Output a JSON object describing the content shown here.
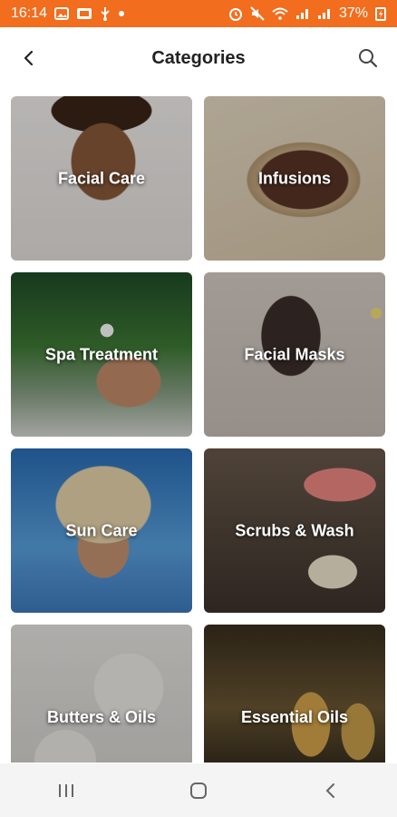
{
  "status_bar": {
    "time": "16:14",
    "battery": "37%",
    "left_icons": [
      "image-icon",
      "gallery-icon",
      "usb-icon",
      "dot-icon"
    ],
    "right_icons": [
      "alarm-icon",
      "mute-icon",
      "wifi-icon",
      "signal-icon",
      "signal-icon",
      "charging-icon"
    ]
  },
  "app_bar": {
    "title": "Categories",
    "back_icon": "back-arrow-icon",
    "search_icon": "search-icon"
  },
  "categories": [
    {
      "label": "Facial Care"
    },
    {
      "label": "Infusions"
    },
    {
      "label": "Spa Treatment"
    },
    {
      "label": "Facial Masks"
    },
    {
      "label": "Sun Care"
    },
    {
      "label": "Scrubs & Wash"
    },
    {
      "label": "Butters & Oils"
    },
    {
      "label": "Essential Oils"
    }
  ],
  "nav_bar": {
    "items": [
      "recent-apps-icon",
      "home-icon",
      "back-icon"
    ]
  },
  "colors": {
    "status_bar": "#f26d1d",
    "title_text": "#222222",
    "card_text": "#ffffff",
    "nav_bar": "#f4f4f4"
  }
}
